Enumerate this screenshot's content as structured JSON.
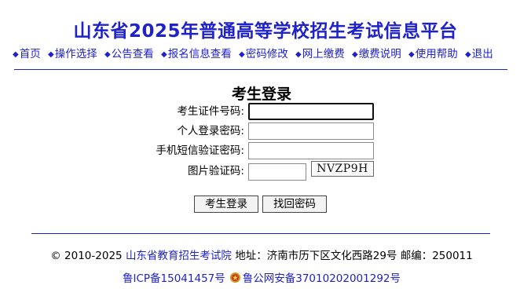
{
  "header": {
    "title": "山东省2025年普通高等学校招生考试信息平台"
  },
  "nav": {
    "items": [
      "首页",
      "操作选择",
      "公告查看",
      "报名信息查看",
      "密码修改",
      "网上缴费",
      "缴费说明",
      "使用帮助",
      "退出"
    ]
  },
  "login": {
    "title": "考生登录",
    "fields": {
      "id_label": "考生证件号码:",
      "id_value": "",
      "password_label": "个人登录密码:",
      "password_value": "",
      "sms_label": "手机短信验证密码:",
      "sms_value": "",
      "captcha_label": "图片验证码:",
      "captcha_value": "",
      "captcha_image_text": "NVZP9H"
    },
    "buttons": {
      "login": "考生登录",
      "recover": "找回密码"
    }
  },
  "footer": {
    "copyright": "© 2010-2025",
    "org_link": "山东省教育招生考试院",
    "address": "地址：济南市历下区文化西路29号 邮编：250011",
    "icp": "鲁ICP备15041457号",
    "police": "鲁公网安备37010202001292号"
  },
  "colors": {
    "accent": "#1f22c8"
  }
}
